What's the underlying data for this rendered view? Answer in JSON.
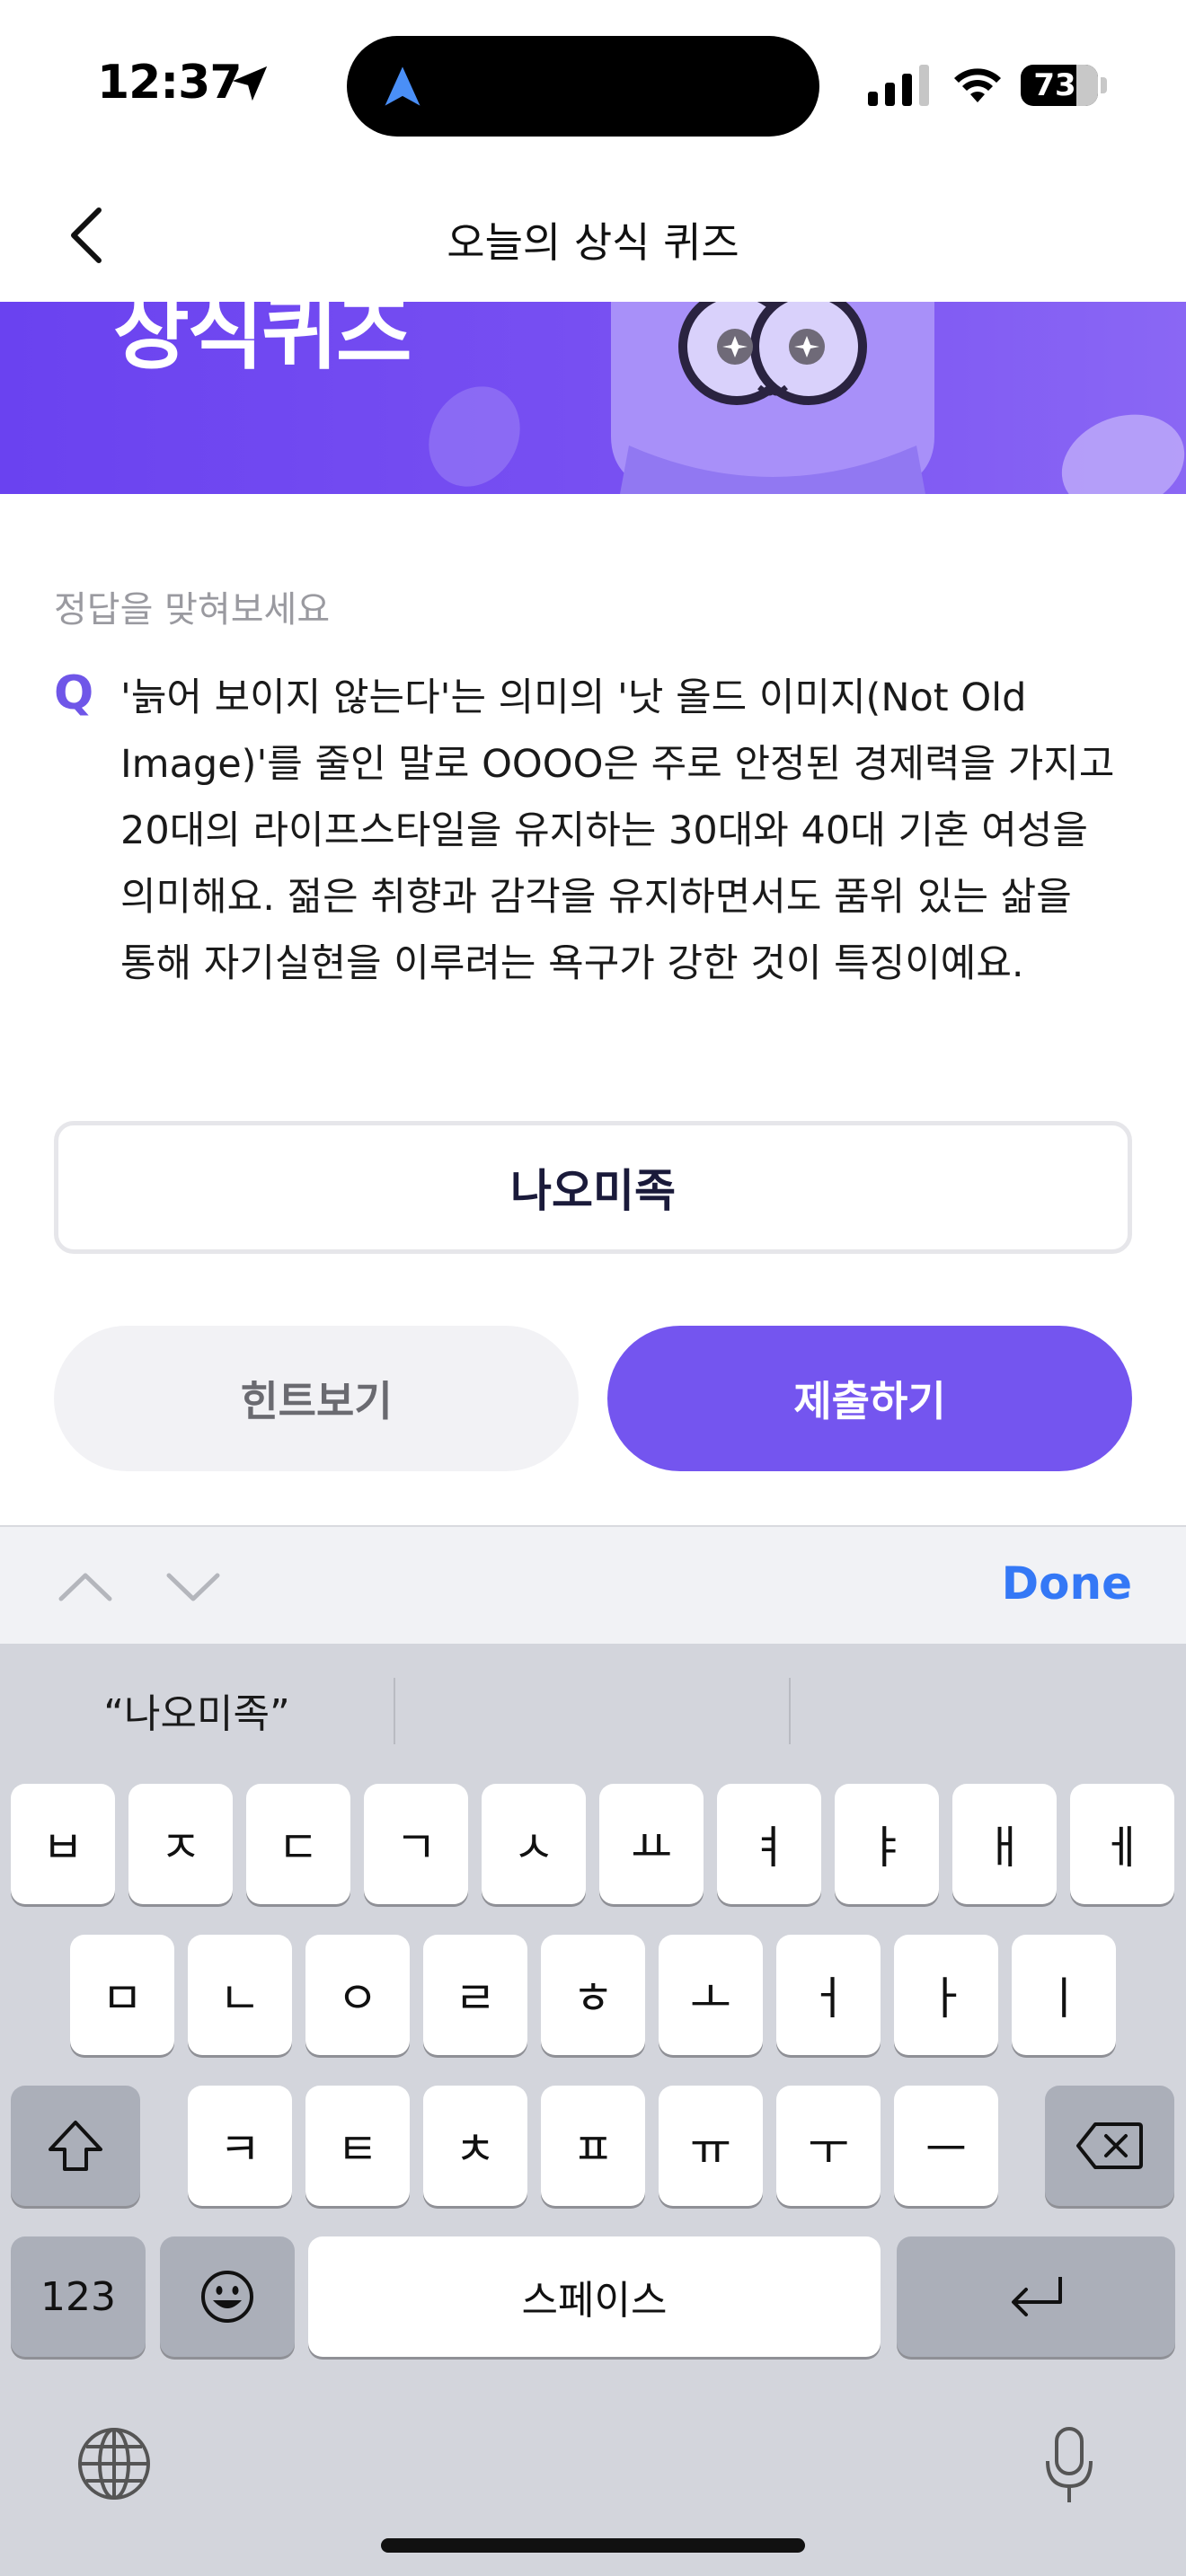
{
  "status_bar": {
    "time": "12:37",
    "battery": "73"
  },
  "header": {
    "title": "오늘의 상식 퀴즈"
  },
  "banner": {
    "title": "상식퀴즈"
  },
  "quiz": {
    "prompt": "정답을 맞혀보세요",
    "q_mark": "Q",
    "question": "'늙어 보이지 않는다'는 의미의 '낫 올드 이미지(Not Old Image)'를 줄인 말로 OOOO은 주로 안정된 경제력을 가지고 20대의 라이프스타일을 유지하는 30대와 40대 기혼 여성을 의미해요. 젊은 취향과 감각을 유지하면서도 품위 있는 삶을 통해 자기실현을 이루려는 욕구가 강한 것이 특징이예요.",
    "answer": "나오미족",
    "hint_label": "힌트보기",
    "submit_label": "제출하기"
  },
  "accessory": {
    "done_label": "Done"
  },
  "keyboard": {
    "suggestion": "“나오미족”",
    "row1": [
      "ㅂ",
      "ㅈ",
      "ㄷ",
      "ㄱ",
      "ㅅ",
      "ㅛ",
      "ㅕ",
      "ㅑ",
      "ㅐ",
      "ㅔ"
    ],
    "row2": [
      "ㅁ",
      "ㄴ",
      "ㅇ",
      "ㄹ",
      "ㅎ",
      "ㅗ",
      "ㅓ",
      "ㅏ",
      "ㅣ"
    ],
    "row3": [
      "ㅋ",
      "ㅌ",
      "ㅊ",
      "ㅍ",
      "ㅠ",
      "ㅜ",
      "ㅡ"
    ],
    "numbers_label": "123",
    "space_label": "스페이스"
  },
  "colors": {
    "accent": "#7455ef",
    "banner": "#6a42f0",
    "done": "#3478f6"
  }
}
